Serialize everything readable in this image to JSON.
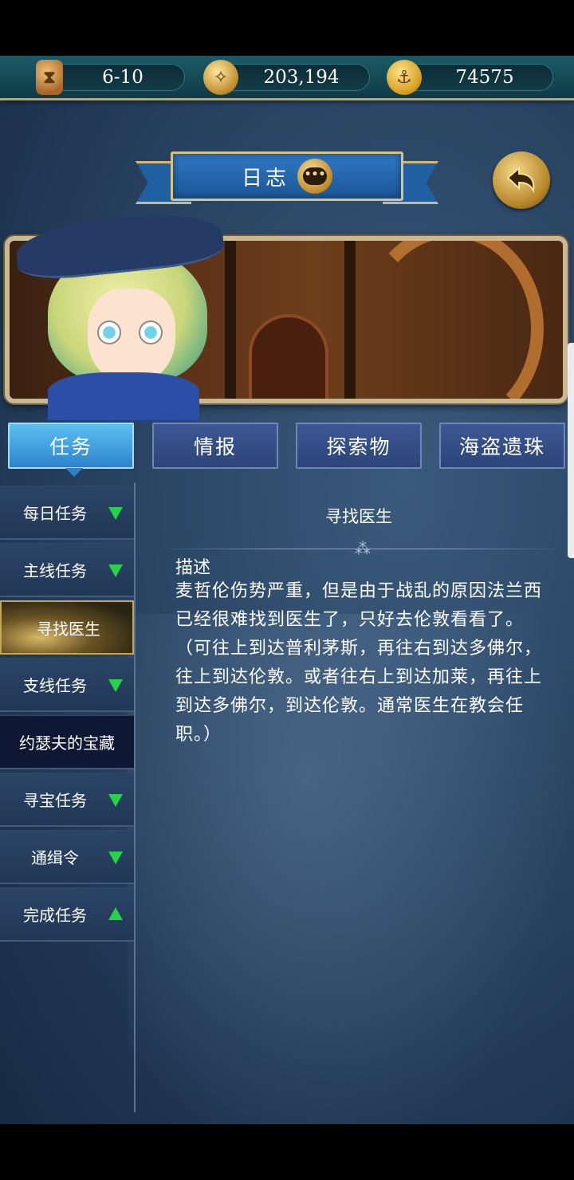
{
  "resources": {
    "turns": "6-10",
    "gold": "203,194",
    "coins": "74575"
  },
  "icons": {
    "hourglass": "hourglass-icon",
    "compass": "compass-icon",
    "coin": "anchor-coin-icon",
    "chat": "chat-bubble-icon",
    "back": "back-arrow-icon"
  },
  "header": {
    "title": "日志",
    "chat_glyph": "•••"
  },
  "tabs": [
    {
      "label": "任务",
      "active": true
    },
    {
      "label": "情报",
      "active": false
    },
    {
      "label": "探索物",
      "active": false
    },
    {
      "label": "海盗遗珠",
      "active": false
    }
  ],
  "sidebar": {
    "items": [
      {
        "label": "每日任务",
        "arrow": "down"
      },
      {
        "label": "主线任务",
        "arrow": "down"
      },
      {
        "label": "寻找医生",
        "arrow": "none",
        "selected": true
      },
      {
        "label": "支线任务",
        "arrow": "down"
      },
      {
        "label": "约瑟夫的宝藏",
        "arrow": "none"
      },
      {
        "label": "寻宝任务",
        "arrow": "down"
      },
      {
        "label": "通缉令",
        "arrow": "down"
      },
      {
        "label": "完成任务",
        "arrow": "up"
      }
    ]
  },
  "quest": {
    "title": "寻找医生",
    "divider_glyph": "⁂",
    "desc_label": "描述",
    "description": "麦哲伦伤势严重，但是由于战乱的原因法兰西已经很难找到医生了，只好去伦敦看看了。（可往上到达普利茅斯，再往右到达多佛尔，往上到达伦敦。或者往右上到达加莱，再往上到达多佛尔，到达伦敦。通常医生在教会任职。）"
  },
  "colors": {
    "accent_green": "#26d24a",
    "tab_active": "#2d82cc",
    "frame_gold": "#c9b892"
  }
}
